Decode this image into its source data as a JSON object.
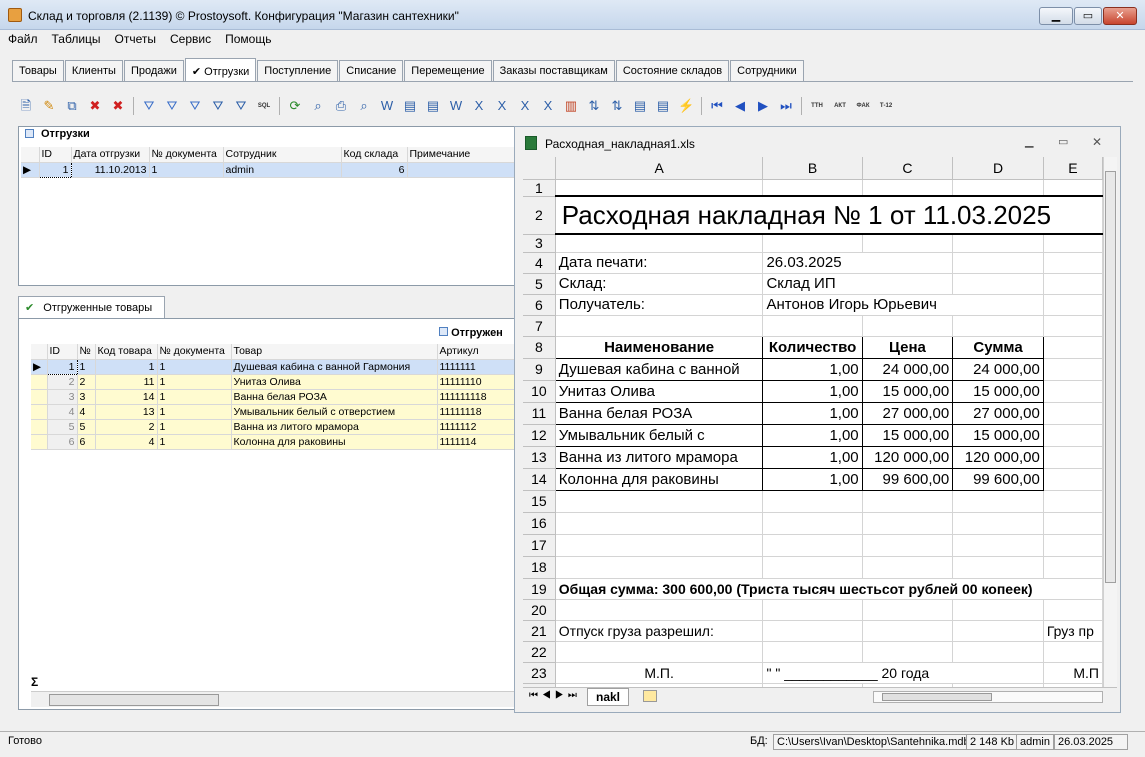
{
  "window": {
    "title": "Склад и торговля (2.1139) © Prostoysoft. Конфигурация \"Магазин сантехники\"",
    "min": "▁",
    "max": "▭",
    "close": "✕"
  },
  "menu": [
    "Файл",
    "Таблицы",
    "Отчеты",
    "Сервис",
    "Помощь"
  ],
  "tabs": [
    "Товары",
    "Клиенты",
    "Продажи",
    "✔ Отгрузки",
    "Поступление",
    "Списание",
    "Перемещение",
    "Заказы поставщикам",
    "Состояние складов",
    "Сотрудники"
  ],
  "toolbar_icons": [
    "export-icon",
    "edit-icon",
    "copy-icon",
    "delete-icon",
    "delete-all-icon",
    "filter-icon",
    "filter-add-icon",
    "filter-remove-icon",
    "filter-set-icon",
    "tree-filter-icon",
    "sql-icon",
    "refresh-icon",
    "find-icon",
    "print-icon",
    "preview-icon",
    "word-icon",
    "report-icon",
    "report2-icon",
    "word2-icon",
    "excel-icon",
    "excel2-icon",
    "excel3-icon",
    "excel4-icon",
    "chart-icon",
    "sort-icon",
    "sort2-icon",
    "list-icon",
    "list2-icon",
    "flash-icon",
    "first-icon",
    "prev-icon",
    "next-icon",
    "last-icon",
    "ttn-icon",
    "akt-icon",
    "fak-icon",
    "t12-icon"
  ],
  "toolbar_labels": {
    "sql": "SQL",
    "ttn": "ТТН",
    "akt": "АКТ",
    "fak": "ФАК",
    "t12": "Т-12"
  },
  "shipments": {
    "title": "Отгрузки",
    "columns": [
      "ID",
      "Дата отгрузки",
      "№ документа",
      "Сотрудник",
      "Код склада",
      "Примечание"
    ],
    "rows": [
      {
        "id": "1",
        "date": "11.10.2013",
        "doc": "1",
        "employee": "admin",
        "warehouse": "6",
        "note": ""
      }
    ]
  },
  "goods_tab": "Отгруженные товары",
  "goods": {
    "group_header": "Отгружен",
    "columns": [
      "ID",
      "№",
      "Код товара",
      "№ документа",
      "Товар",
      "Артикул"
    ],
    "rows": [
      {
        "id": "1",
        "n": "1",
        "code": "1",
        "doc": "1",
        "name": "Душевая кабина с ванной Гармония",
        "art": "1111111"
      },
      {
        "id": "2",
        "n": "2",
        "code": "11",
        "doc": "1",
        "name": "Унитаз Олива",
        "art": "11111110"
      },
      {
        "id": "3",
        "n": "3",
        "code": "14",
        "doc": "1",
        "name": "Ванна белая РОЗА",
        "art": "111111118"
      },
      {
        "id": "4",
        "n": "4",
        "code": "13",
        "doc": "1",
        "name": "Умывальник белый с отверстием",
        "art": "11111118"
      },
      {
        "id": "5",
        "n": "5",
        "code": "2",
        "doc": "1",
        "name": "Ванна из литого мрамора",
        "art": "1111112"
      },
      {
        "id": "6",
        "n": "6",
        "code": "4",
        "doc": "1",
        "name": "Колонна  для раковины",
        "art": "1111114"
      }
    ],
    "sum_symbol": "Σ"
  },
  "excel": {
    "title": "Расходная_накладная1.xls",
    "cols": [
      "A",
      "B",
      "C",
      "D",
      "E"
    ],
    "r2": "Расходная накладная № 1 от 11.03.2025",
    "print_label": "Дата печати:",
    "print_date": "26.03.2025",
    "store_label": "Склад:",
    "store": "Склад ИП",
    "recv_label": "Получатель:",
    "recv": "Антонов Игорь Юрьевич",
    "head": [
      "Наименование",
      "Количество",
      "Цена",
      "Сумма"
    ],
    "items": [
      [
        "Душевая кабина с ванной",
        "1,00",
        "24 000,00",
        "24 000,00"
      ],
      [
        "Унитаз Олива",
        "1,00",
        "15 000,00",
        "15 000,00"
      ],
      [
        "Ванна белая РОЗА",
        "1,00",
        "27 000,00",
        "27 000,00"
      ],
      [
        "Умывальник белый с",
        "1,00",
        "15 000,00",
        "15 000,00"
      ],
      [
        "Ванна из литого мрамора",
        "1,00",
        "120 000,00",
        "120 000,00"
      ],
      [
        "Колонна  для раковины",
        "1,00",
        "99 600,00",
        "99 600,00"
      ]
    ],
    "total": "Общая сумма: 300 600,00 (Триста тысяч шестьсот рублей 00 копеек)",
    "release": "Отпуск груза разрешил:",
    "cargo": "Груз пр",
    "mp": "М.П.",
    "date_line": "\"   \" ____________ 20     года",
    "mp2": "М.П",
    "sheet_tab": "nakl"
  },
  "status": {
    "ready": "Готово",
    "db_label": "БД:",
    "db": "C:\\Users\\Ivan\\Desktop\\Santehnika.mdb",
    "size": "2 148 Kb",
    "user": "admin",
    "date": "26.03.2025"
  }
}
